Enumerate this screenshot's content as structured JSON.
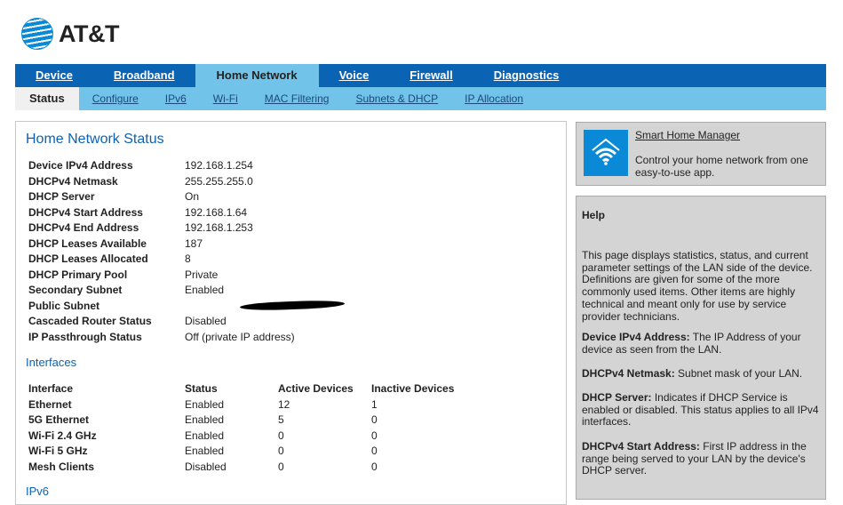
{
  "brand": {
    "name": "AT&T"
  },
  "nav": {
    "primary": [
      "Device",
      "Broadband",
      "Home Network",
      "Voice",
      "Firewall",
      "Diagnostics"
    ],
    "secondary": [
      "Status",
      "Configure",
      "IPv6",
      "Wi-Fi",
      "MAC Filtering",
      "Subnets & DHCP",
      "IP Allocation"
    ]
  },
  "main": {
    "title": "Home Network Status",
    "status": [
      {
        "label": "Device IPv4 Address",
        "value": "192.168.1.254"
      },
      {
        "label": "DHCPv4 Netmask",
        "value": "255.255.255.0"
      },
      {
        "label": "DHCP Server",
        "value": "On"
      },
      {
        "label": "DHCPv4 Start Address",
        "value": "192.168.1.64"
      },
      {
        "label": "DHCPv4 End Address",
        "value": "192.168.1.253"
      },
      {
        "label": "DHCP Leases Available",
        "value": "187"
      },
      {
        "label": "DHCP Leases Allocated",
        "value": "8"
      },
      {
        "label": "DHCP Primary Pool",
        "value": "Private"
      },
      {
        "label": "Secondary Subnet",
        "value": "Enabled"
      },
      {
        "label": "Public Subnet",
        "value": ""
      },
      {
        "label": "Cascaded Router Status",
        "value": "Disabled"
      },
      {
        "label": "IP Passthrough Status",
        "value": "Off (private IP address)"
      }
    ],
    "interfaces_title": "Interfaces",
    "interfaces_headers": [
      "Interface",
      "Status",
      "Active Devices",
      "Inactive Devices"
    ],
    "interfaces": [
      [
        "Ethernet",
        "Enabled",
        "12",
        "1"
      ],
      [
        "5G Ethernet",
        "Enabled",
        "5",
        "0"
      ],
      [
        "Wi-Fi 2.4 GHz",
        "Enabled",
        "0",
        "0"
      ],
      [
        "Wi-Fi 5 GHz",
        "Enabled",
        "0",
        "0"
      ],
      [
        "Mesh Clients",
        "Disabled",
        "0",
        "0"
      ]
    ],
    "next_section": "IPv6"
  },
  "smart_home": {
    "link": "Smart Home Manager",
    "description": "Control your home network from one easy-to-use app."
  },
  "help": {
    "title": "Help",
    "intro": "This page displays statistics, status, and current parameter settings of the LAN side of the device. Definitions are given for some of the more commonly used items. Other items are highly technical and meant only for use by service provider technicians.",
    "items": [
      {
        "term": "Device IPv4 Address:",
        "text": " The IP Address of your device as seen from the LAN."
      },
      {
        "term": "DHCPv4 Netmask:",
        "text": " Subnet mask of your LAN."
      },
      {
        "term": "DHCP Server:",
        "text": " Indicates if DHCP Service is enabled or disabled. This status applies to all IPv4 interfaces."
      },
      {
        "term": "DHCPv4 Start Address:",
        "text": " First IP address in the range being served to your LAN by the device's DHCP server."
      }
    ]
  }
}
